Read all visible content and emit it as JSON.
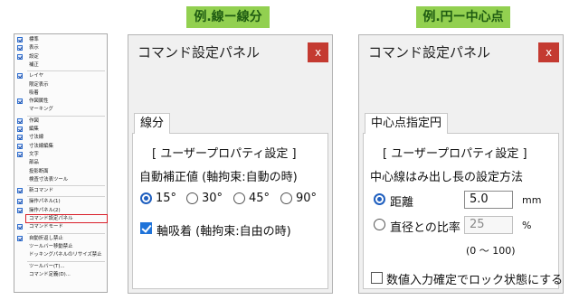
{
  "tags": {
    "left": "例.線ー線分",
    "right": "例.円ー中心点"
  },
  "menu": {
    "items": [
      {
        "label": "標準",
        "checked": true
      },
      {
        "label": "表示",
        "checked": true
      },
      {
        "label": "設定",
        "checked": true
      },
      {
        "label": "補正",
        "checked": false
      },
      {
        "label": "レイヤ",
        "checked": true
      },
      {
        "label": "限定表示",
        "checked": false
      },
      {
        "label": "吸着",
        "checked": false
      },
      {
        "label": "作図属性",
        "checked": true
      },
      {
        "label": "マーキング",
        "checked": false
      },
      {
        "label": "作図",
        "checked": true
      },
      {
        "label": "編集",
        "checked": true
      },
      {
        "label": "寸法線",
        "checked": true
      },
      {
        "label": "寸法線編集",
        "checked": true
      },
      {
        "label": "文字",
        "checked": true
      },
      {
        "label": "部品",
        "checked": false
      },
      {
        "label": "投影断面",
        "checked": false
      },
      {
        "label": "検査寸法表ツール",
        "checked": false
      },
      {
        "label": "新コマンド",
        "checked": true
      },
      {
        "label": "操作パネル(1)",
        "checked": true
      },
      {
        "label": "操作パネル(2)",
        "checked": true
      },
      {
        "label": "コマンド設定パネル",
        "checked": false,
        "highlight": true
      },
      {
        "label": "コマンドモード",
        "checked": true
      },
      {
        "label": "自動折返し禁止",
        "checked": true
      },
      {
        "label": "ツールバー移動禁止",
        "checked": false
      },
      {
        "label": "ドッキングパネルのリサイズ禁止",
        "checked": false
      },
      {
        "label": "ツールバー(T)...",
        "checked": false
      },
      {
        "label": "コマンド定義(D)...",
        "checked": false
      }
    ]
  },
  "panel_line": {
    "title": "コマンド設定パネル",
    "close": "x",
    "tab": "線分",
    "section": "[ ユーザープロパティ設定 ]",
    "auto_label": "自動補正値 (軸拘束:自動の時)",
    "angles": [
      "15°",
      "30°",
      "45°",
      "90°"
    ],
    "angle_selected": "15°",
    "snap_label": "軸吸着 (軸拘束:自由の時)",
    "snap_checked": true
  },
  "panel_circle": {
    "title": "コマンド設定パネル",
    "close": "x",
    "tab": "中心点指定円",
    "section": "[ ユーザープロパティ設定 ]",
    "method_label": "中心線はみ出し長の設定方法",
    "distance_label": "距離",
    "distance_value": "5.0",
    "distance_unit": "mm",
    "ratio_label": "直径との比率",
    "ratio_value": "25",
    "ratio_unit": "%",
    "range_note": "(0 〜 100)",
    "lock_label": "数値入力確定でロック状態にする",
    "lock_checked": false,
    "selected_method": "距離"
  }
}
